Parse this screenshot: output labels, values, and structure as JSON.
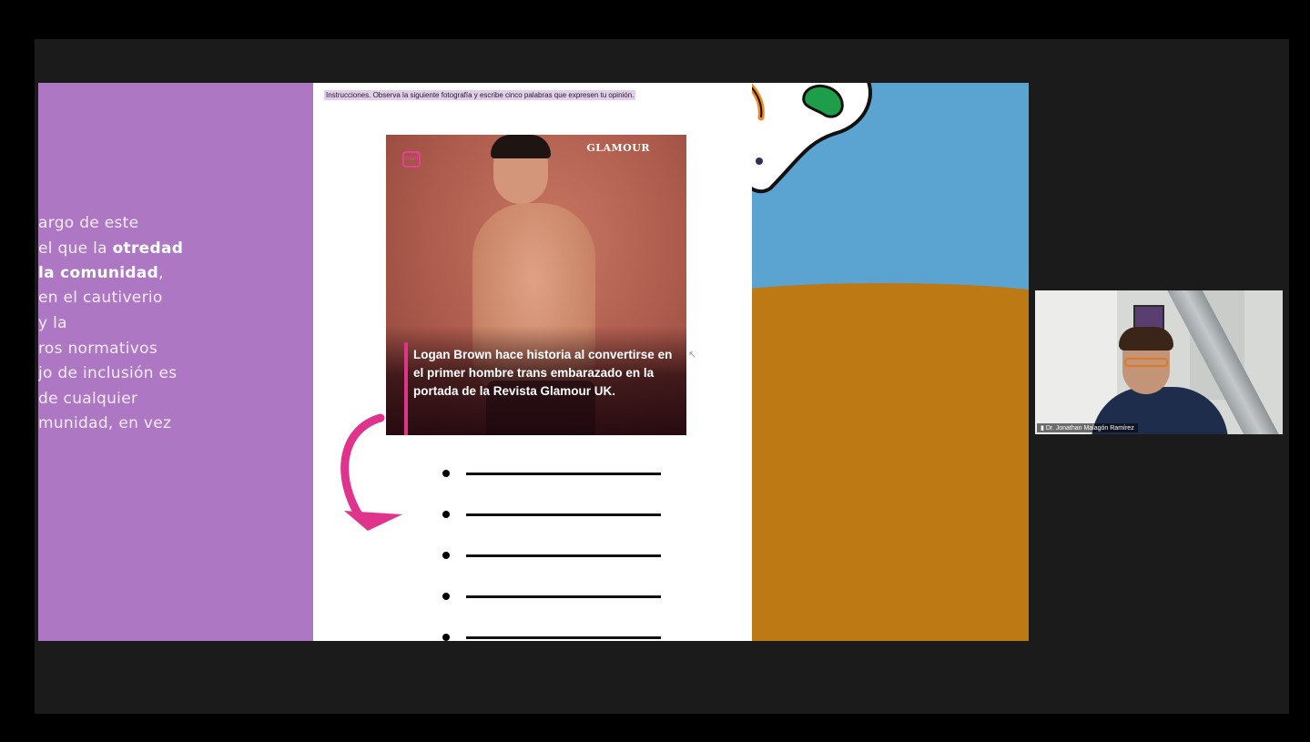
{
  "slide_text": {
    "line1": "argo de este",
    "line2_pre": "el que la ",
    "line2_bold": "otredad",
    "line3_bold": "la comunidad",
    "line3_post": ",",
    "line4": "en el cautiverio",
    "line5": "y la",
    "line6": "ros normativos",
    "line7": "jo de inclusión es",
    "line8": "de cualquier",
    "line9": "munidad, en vez"
  },
  "worksheet": {
    "instructions": "Instrucciones. Observa la siguiente fotografía y escribe cinco palabras que expresen tu opinión.",
    "magazine_name": "GLAMOUR",
    "magazine_logo": "Glam",
    "caption": "Logan Brown hace historia al convertirse en el primer hombre trans embarazado en la portada de la Revista Glamour UK.",
    "answer_lines": 5
  },
  "video_participant": {
    "name": "Dr. Jonathan Malagón Ramírez"
  },
  "colors": {
    "left_panel": "#ae77c4",
    "sky": "#5ba3d1",
    "ground": "#bd7914",
    "accent_pink": "#e0338c",
    "blob_green": "#1f9e4a",
    "blob_orange": "#f08a1c"
  }
}
